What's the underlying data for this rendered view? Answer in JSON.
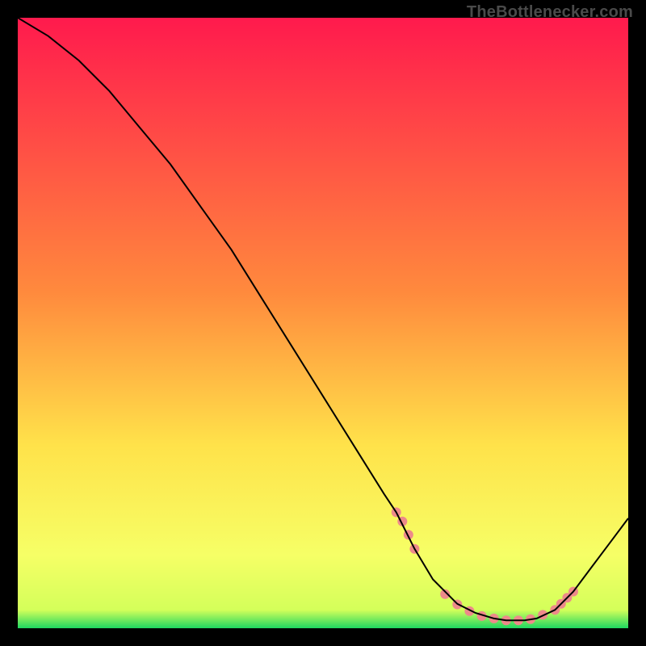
{
  "watermark": "TheBottlenecker.com",
  "chart_data": {
    "type": "line",
    "title": "",
    "xlabel": "",
    "ylabel": "",
    "xlim": [
      0,
      100
    ],
    "ylim": [
      0,
      100
    ],
    "grid": false,
    "legend": false,
    "axes_hidden": true,
    "background_gradient": {
      "stops": [
        {
          "offset": 0,
          "color": "#ff1a4d"
        },
        {
          "offset": 45,
          "color": "#ff8a3d"
        },
        {
          "offset": 70,
          "color": "#ffe24a"
        },
        {
          "offset": 88,
          "color": "#f6ff66"
        },
        {
          "offset": 97,
          "color": "#d4ff5a"
        },
        {
          "offset": 100,
          "color": "#1ed760"
        }
      ]
    },
    "series": [
      {
        "name": "bottleneck-curve",
        "color": "#000000",
        "x": [
          0,
          5,
          10,
          15,
          20,
          25,
          30,
          35,
          40,
          45,
          50,
          55,
          60,
          62,
          65,
          68,
          72,
          75,
          78,
          80,
          83,
          85,
          88,
          91,
          94,
          97,
          100
        ],
        "y": [
          100,
          97,
          93,
          88,
          82,
          76,
          69,
          62,
          54,
          46,
          38,
          30,
          22,
          19,
          13,
          8,
          4,
          2.5,
          1.6,
          1.3,
          1.3,
          1.6,
          3,
          6,
          10,
          14,
          18
        ]
      }
    ],
    "markers": {
      "name": "minimum-band",
      "color": "#ed8a8a",
      "radius": 6,
      "points": [
        {
          "x": 62,
          "y": 19
        },
        {
          "x": 63,
          "y": 17.5
        },
        {
          "x": 64,
          "y": 15.3
        },
        {
          "x": 65,
          "y": 13
        },
        {
          "x": 70,
          "y": 5.6
        },
        {
          "x": 72,
          "y": 3.9
        },
        {
          "x": 74,
          "y": 2.8
        },
        {
          "x": 76,
          "y": 2.0
        },
        {
          "x": 78,
          "y": 1.6
        },
        {
          "x": 80,
          "y": 1.3
        },
        {
          "x": 82,
          "y": 1.3
        },
        {
          "x": 84,
          "y": 1.5
        },
        {
          "x": 86,
          "y": 2.2
        },
        {
          "x": 88,
          "y": 3.0
        },
        {
          "x": 89,
          "y": 4.0
        },
        {
          "x": 90,
          "y": 5.0
        },
        {
          "x": 91,
          "y": 6.0
        }
      ]
    }
  }
}
